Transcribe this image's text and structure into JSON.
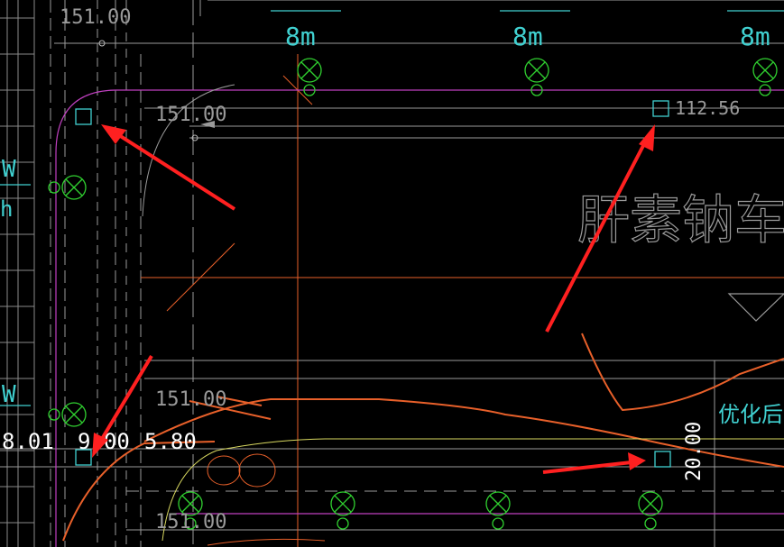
{
  "drawing": {
    "labels": {
      "elev_top": "151.00",
      "spacing_1": "8m",
      "spacing_2": "8m",
      "spacing_3": "8m",
      "elev_mid": "151.00",
      "point_elev": "112.56",
      "building_name": "肝素钠车间",
      "left_w1": "W",
      "left_w2": "W",
      "left_h": "h",
      "elev_lower": "151.00",
      "dim_left": "8.01",
      "dim_center": "9.00",
      "dim_right": "5.80",
      "dim_vertical": "20.00",
      "optimize_note": "优化后",
      "elev_bottom": "151.00"
    },
    "colors": {
      "grid": "#9a9a9a",
      "orange": "#e8602a",
      "magenta": "#c040c0",
      "green": "#30d030",
      "cyan": "#40d0d0",
      "arrow": "#ff2020",
      "yellow": "#d8d860"
    }
  }
}
